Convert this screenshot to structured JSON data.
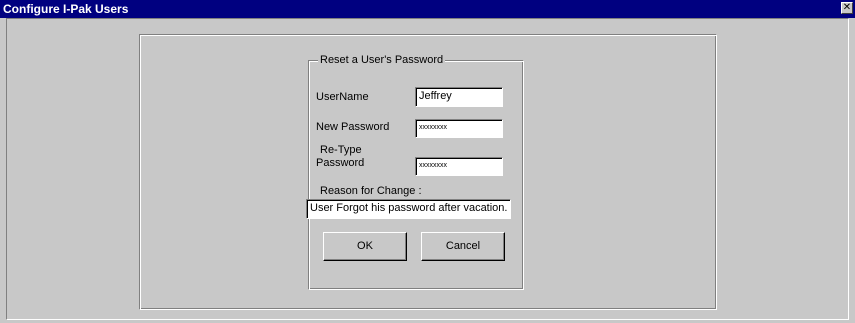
{
  "window": {
    "title": "Configure I-Pak Users",
    "close_glyph": "✕"
  },
  "group": {
    "legend": "Reset a User's Password"
  },
  "fields": {
    "username_label": "UserName",
    "username_value": "Jeffrey",
    "new_password_label": "New Password",
    "new_password_value": "xxxxxxxx",
    "retype_label_line1": "Re-Type",
    "retype_label_line2": "Password",
    "retype_value": "xxxxxxxx",
    "reason_label": "Reason for Change :",
    "reason_value": "User Forgot his password after vacation."
  },
  "buttons": {
    "ok_label": "OK",
    "cancel_label": "Cancel"
  },
  "colors": {
    "titlebar": "#000080",
    "dialog_face": "#c8c8c8"
  }
}
